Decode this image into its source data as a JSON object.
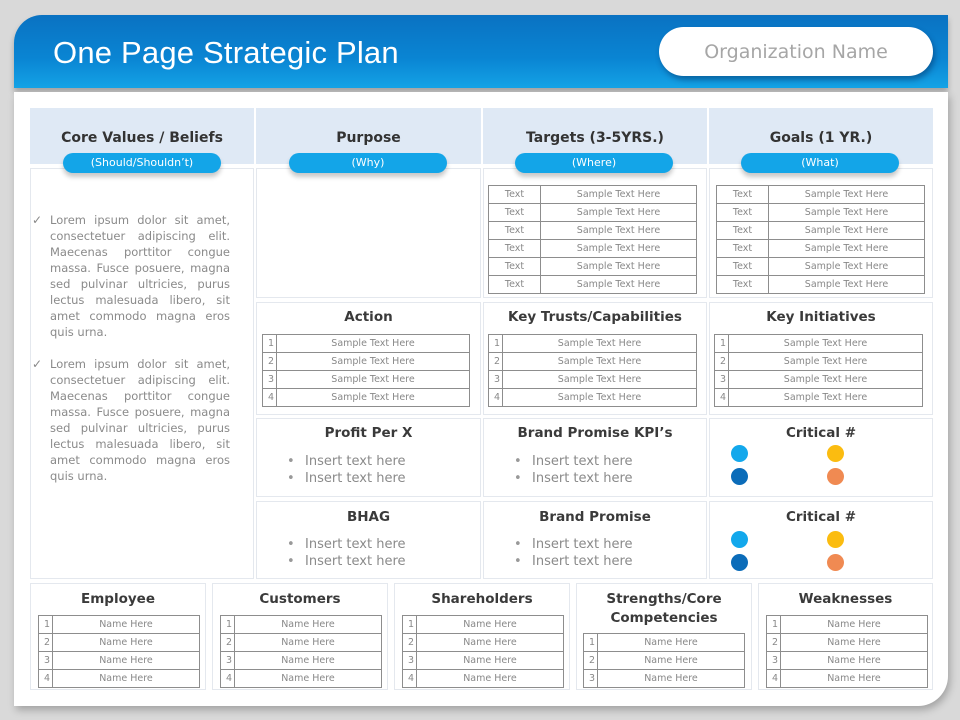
{
  "header": {
    "title": "One Page Strategic Plan",
    "organization_placeholder": "Organization Name"
  },
  "columns": [
    {
      "title": "Core Values / Beliefs",
      "pill": "(Should/Shouldn’t)"
    },
    {
      "title": "Purpose",
      "pill": "(Why)"
    },
    {
      "title": "Targets (3-5YRS.)",
      "pill": "(Where)"
    },
    {
      "title": "Goals (1 YR.)",
      "pill": "(What)"
    }
  ],
  "core_values": {
    "paragraphs": [
      "Lorem ipsum dolor sit amet, consectetuer adipiscing elit. Maecenas porttitor congue massa. Fusce posuere, magna sed pulvinar ultricies, purus lectus malesuada libero, sit amet commodo magna eros quis urna.",
      "Lorem ipsum dolor sit amet, consectetuer adipiscing elit. Maecenas porttitor congue massa. Fusce posuere, magna sed pulvinar ultricies, purus lectus malesuada libero, sit amet commodo magna eros quis urna."
    ],
    "check_icon": "✓"
  },
  "targets": {
    "rows": [
      {
        "label": "Text",
        "value": "Sample Text Here"
      },
      {
        "label": "Text",
        "value": "Sample Text Here"
      },
      {
        "label": "Text",
        "value": "Sample Text Here"
      },
      {
        "label": "Text",
        "value": "Sample Text Here"
      },
      {
        "label": "Text",
        "value": "Sample Text Here"
      },
      {
        "label": "Text",
        "value": "Sample Text Here"
      }
    ]
  },
  "goals": {
    "rows": [
      {
        "label": "Text",
        "value": "Sample Text Here"
      },
      {
        "label": "Text",
        "value": "Sample Text Here"
      },
      {
        "label": "Text",
        "value": "Sample Text Here"
      },
      {
        "label": "Text",
        "value": "Sample Text Here"
      },
      {
        "label": "Text",
        "value": "Sample Text Here"
      },
      {
        "label": "Text",
        "value": "Sample Text Here"
      }
    ]
  },
  "action": {
    "title": "Action",
    "rows": [
      {
        "n": "1",
        "value": "Sample Text Here"
      },
      {
        "n": "2",
        "value": "Sample Text Here"
      },
      {
        "n": "3",
        "value": "Sample Text Here"
      },
      {
        "n": "4",
        "value": "Sample Text Here"
      }
    ]
  },
  "key_trusts": {
    "title": "Key Trusts/Capabilities",
    "rows": [
      {
        "n": "1",
        "value": "Sample Text Here"
      },
      {
        "n": "2",
        "value": "Sample Text Here"
      },
      {
        "n": "3",
        "value": "Sample Text Here"
      },
      {
        "n": "4",
        "value": "Sample Text Here"
      }
    ]
  },
  "key_initiatives": {
    "title": "Key Initiatives",
    "rows": [
      {
        "n": "1",
        "value": "Sample Text Here"
      },
      {
        "n": "2",
        "value": "Sample Text Here"
      },
      {
        "n": "3",
        "value": "Sample Text Here"
      },
      {
        "n": "4",
        "value": "Sample Text Here"
      }
    ]
  },
  "profit_per_x": {
    "title": "Profit Per X",
    "items": [
      "Insert text here",
      "Insert text here"
    ]
  },
  "brand_promise_kpis": {
    "title": "Brand Promise KPI’s",
    "items": [
      "Insert text here",
      "Insert text here"
    ]
  },
  "bhag": {
    "title": "BHAG",
    "items": [
      "Insert text here",
      "Insert text here"
    ]
  },
  "brand_promise": {
    "title": "Brand Promise",
    "items": [
      "Insert text here",
      "Insert text here"
    ]
  },
  "critical_1": {
    "title": "Critical #",
    "colors": [
      "#13a8ec",
      "#fbbc10",
      "#0b6cb9",
      "#f08a52"
    ]
  },
  "critical_2": {
    "title": "Critical #",
    "colors": [
      "#13a8ec",
      "#fbbc10",
      "#0b6cb9",
      "#f08a52"
    ]
  },
  "bottom": [
    {
      "title": "Employee",
      "rows": [
        {
          "n": "1",
          "value": "Name Here"
        },
        {
          "n": "2",
          "value": "Name Here"
        },
        {
          "n": "3",
          "value": "Name Here"
        },
        {
          "n": "4",
          "value": "Name Here"
        }
      ]
    },
    {
      "title": "Customers",
      "rows": [
        {
          "n": "1",
          "value": "Name Here"
        },
        {
          "n": "2",
          "value": "Name Here"
        },
        {
          "n": "3",
          "value": "Name Here"
        },
        {
          "n": "4",
          "value": "Name Here"
        }
      ]
    },
    {
      "title": "Shareholders",
      "rows": [
        {
          "n": "1",
          "value": "Name Here"
        },
        {
          "n": "2",
          "value": "Name Here"
        },
        {
          "n": "3",
          "value": "Name Here"
        },
        {
          "n": "4",
          "value": "Name Here"
        }
      ]
    },
    {
      "title": "Strengths/Core Competencies",
      "rows": [
        {
          "n": "1",
          "value": "Name Here"
        },
        {
          "n": "2",
          "value": "Name Here"
        },
        {
          "n": "3",
          "value": "Name Here"
        }
      ]
    },
    {
      "title": "Weaknesses",
      "rows": [
        {
          "n": "1",
          "value": "Name Here"
        },
        {
          "n": "2",
          "value": "Name Here"
        },
        {
          "n": "3",
          "value": "Name Here"
        },
        {
          "n": "4",
          "value": "Name Here"
        }
      ]
    }
  ],
  "bullet_char": "•"
}
